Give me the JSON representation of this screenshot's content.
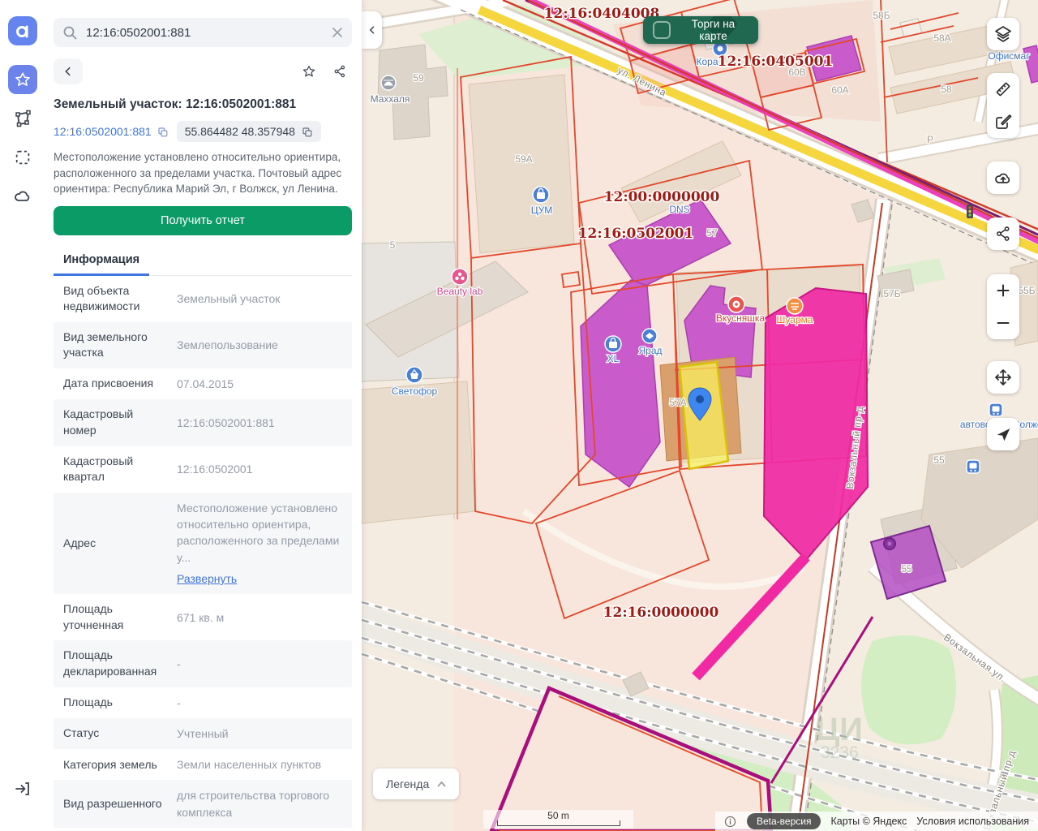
{
  "palette": {
    "accent_blue": "#4077df",
    "report_green": "#0a9b66",
    "trades_green": "#20684f",
    "cadastral_red": "#e2482b",
    "cad_label_red": "#9e1b14",
    "map_magenta": "#c95bcb",
    "zone_pink": "#f12aa4",
    "selected_yellow": "#f5ef5c",
    "rail_active": "#6b83ea"
  },
  "sidebar": {
    "icons": [
      "app-logo",
      "star",
      "polygon-measure",
      "area-select",
      "cloud"
    ],
    "bottom_icon": "sign-in"
  },
  "panel": {
    "search": {
      "value": "12:16:0502001:881"
    },
    "title": "Земельный участок: 12:16:0502001:881",
    "cadastral_link": "12:16:0502001:881",
    "coords_chip": "55.864482 48.357948",
    "description": "Местоположение установлено относительно ориентира, расположенного за пределами участка. Почтовый адрес ориентира: Республика Марий Эл, г Волжск, ул Ленина.",
    "report_button": "Получить отчет",
    "tab": "Информация",
    "rows": [
      {
        "label": "Вид объекта недвижимости",
        "value": "Земельный участок"
      },
      {
        "label": "Вид земельного участка",
        "value": "Землепользование"
      },
      {
        "label": "Дата присвоения",
        "value": "07.04.2015"
      },
      {
        "label": "Кадастровый номер",
        "value": "12:16:0502001:881"
      },
      {
        "label": "Кадастровый квартал",
        "value": "12:16:0502001"
      },
      {
        "label": "Адрес",
        "value": "Местоположение установлено относительно ориентира, расположенного за пределами у...",
        "link": "Развернуть"
      },
      {
        "label": "Площадь уточненная",
        "value": "671 кв. м"
      },
      {
        "label": "Площадь декларированная",
        "value": "-"
      },
      {
        "label": "Площадь",
        "value": "-"
      },
      {
        "label": "Статус",
        "value": "Учтенный"
      },
      {
        "label": "Категория земель",
        "value": "Земли населенных пунктов"
      },
      {
        "label": "Вид разрешенного",
        "value": "для строительства торгового комплекса"
      }
    ]
  },
  "map": {
    "trades_button": "Торги на карте",
    "cadastral_labels": [
      "12:16:0404008",
      "12:16:0405001",
      "12:00:0000000",
      "12:16:0502001",
      "12:16:0000000"
    ],
    "pois": {
      "makhalya": "Маххаля",
      "tsum": "ЦУМ",
      "dns": "DNS",
      "beauty_lab": "Beauty lab",
      "svetofor": "Светофор",
      "xl": "XL",
      "yarad": "Ярад",
      "vkusnyashka": "Вкусняшка",
      "shaurma": "Шуарма",
      "kora": "Кора",
      "ofismag": "Офисмаг",
      "bus_station": "автовокзал Волжск"
    },
    "house_numbers": [
      "59",
      "59А",
      "5",
      "57",
      "57А",
      "57Б",
      "55Б",
      "58Б",
      "58А",
      "58",
      "Р",
      "60В",
      "60А",
      "55",
      "55"
    ],
    "streets": [
      "ул. Ленина",
      "Вокзальный пр-д",
      "Вокзальная ул.",
      "Вокзальный пр-д"
    ],
    "partial_labels": [
      "ЦИ",
      "3236"
    ],
    "legend_button": "Легенда",
    "scale_label": "50 m",
    "beta_badge": "Beta-версия",
    "copyright": "Карты © Яндекс",
    "terms_link": "Условия использования"
  }
}
